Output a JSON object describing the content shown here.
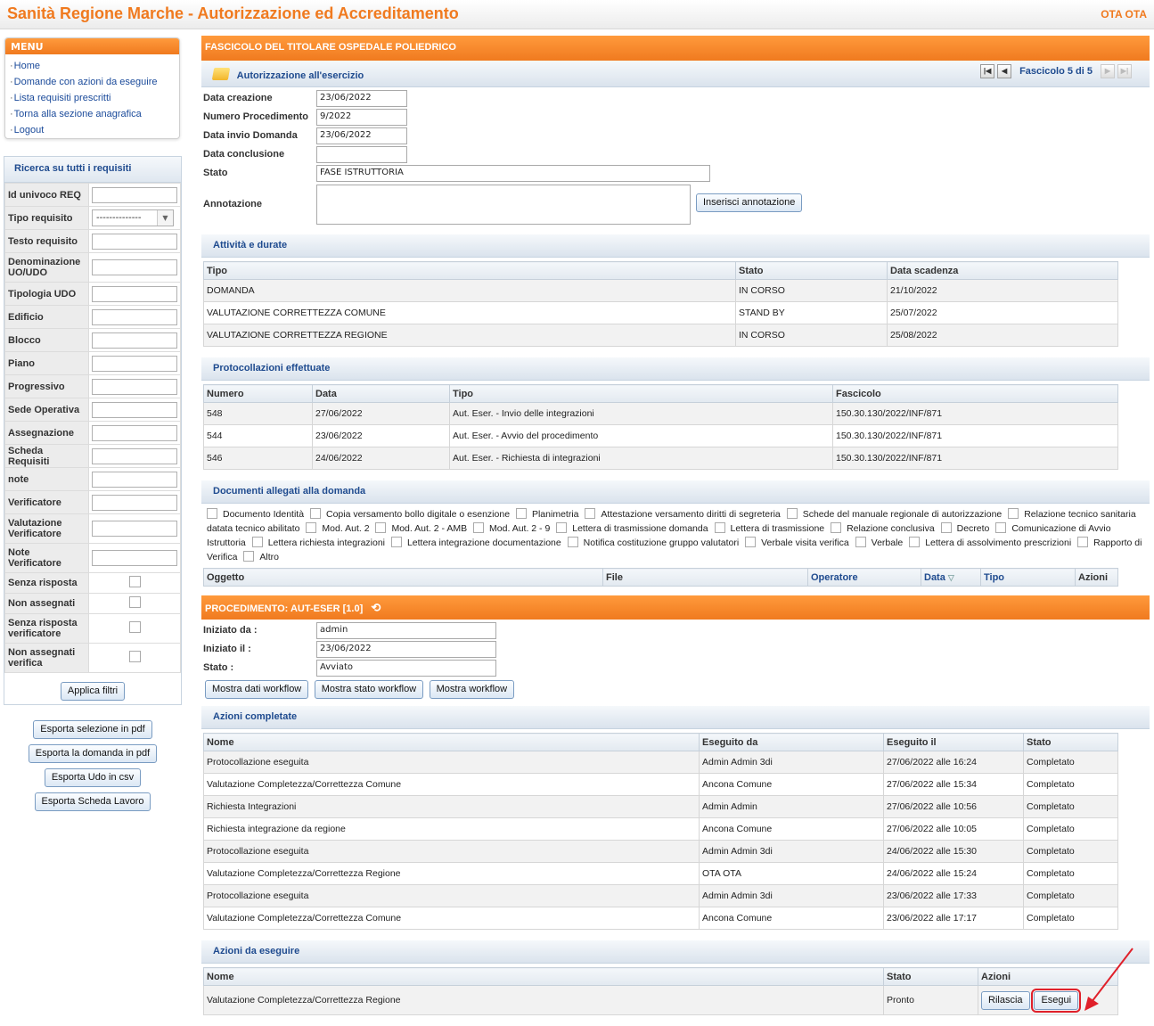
{
  "header": {
    "title": "Sanità Regione Marche - Autorizzazione ed Accreditamento",
    "user": "OTA OTA"
  },
  "menu": {
    "title": "MENU",
    "items": [
      "Home",
      "Domande con azioni da eseguire",
      "Lista requisiti prescritti",
      "Torna alla sezione anagrafica",
      "Logout"
    ]
  },
  "search": {
    "title": "Ricerca su tutti i requisiti",
    "fields": [
      "Id univoco REQ",
      "Tipo requisito",
      "Testo requisito",
      "Denominazione UO/UDO",
      "Tipologia UDO",
      "Edificio",
      "Blocco",
      "Piano",
      "Progressivo",
      "Sede Operativa",
      "Assegnazione",
      "Scheda Requisiti",
      "note",
      "Verificatore",
      "Valutazione Verificatore",
      "Note Verificatore"
    ],
    "tipo_requisito_value": "--------------",
    "checks": [
      "Senza risposta",
      "Non assegnati",
      "Senza risposta verificatore",
      "Non assegnati verifica"
    ],
    "apply": "Applica filtri"
  },
  "exports": [
    "Esporta selezione in pdf",
    "Esporta la domanda in pdf",
    "Esporta Udo in csv",
    "Esporta Scheda Lavoro"
  ],
  "fascicolo": {
    "title": "FASCICOLO DEL TITOLARE OSPEDALE POLIEDRICO",
    "subtitle": "Autorizzazione all'esercizio",
    "pager": "Fascicolo 5 di 5",
    "fields": [
      {
        "label": "Data creazione",
        "value": "23/06/2022"
      },
      {
        "label": "Numero Procedimento",
        "value": "9/2022"
      },
      {
        "label": "Data invio Domanda",
        "value": "23/06/2022"
      },
      {
        "label": "Data conclusione",
        "value": ""
      },
      {
        "label": "Stato",
        "value": "FASE ISTRUTTORIA"
      }
    ],
    "annotation_label": "Annotazione",
    "annotation_button": "Inserisci annotazione"
  },
  "attivita": {
    "title": "Attività e durate",
    "columns": [
      "Tipo",
      "Stato",
      "Data scadenza"
    ],
    "rows": [
      [
        "DOMANDA",
        "IN CORSO",
        "21/10/2022"
      ],
      [
        "VALUTAZIONE CORRETTEZZA COMUNE",
        "STAND BY",
        "25/07/2022"
      ],
      [
        "VALUTAZIONE CORRETTEZZA REGIONE",
        "IN CORSO",
        "25/08/2022"
      ]
    ]
  },
  "protocollazioni": {
    "title": "Protocollazioni effettuate",
    "columns": [
      "Numero",
      "Data",
      "Tipo",
      "Fascicolo"
    ],
    "rows": [
      [
        "548",
        "27/06/2022",
        "Aut. Eser. - Invio delle integrazioni",
        "150.30.130/2022/INF/871"
      ],
      [
        "544",
        "23/06/2022",
        "Aut. Eser. - Avvio del procedimento",
        "150.30.130/2022/INF/871"
      ],
      [
        "546",
        "24/06/2022",
        "Aut. Eser. - Richiesta di integrazioni",
        "150.30.130/2022/INF/871"
      ]
    ]
  },
  "documenti": {
    "title": "Documenti allegati alla domanda",
    "items": [
      "Documento Identità",
      "Copia versamento bollo digitale o esenzione",
      "Planimetria",
      "Attestazione versamento diritti di segreteria",
      "Schede del manuale regionale di autorizzazione",
      "Relazione tecnico sanitaria datata tecnico abilitato",
      "Mod. Aut. 2",
      "Mod. Aut. 2 - AMB",
      "Mod. Aut. 2 - 9",
      "Lettera di trasmissione domanda",
      "Lettera di trasmissione",
      "Relazione conclusiva",
      "Decreto",
      "Comunicazione di Avvio Istruttoria",
      "Lettera richiesta integrazioni",
      "Lettera integrazione documentazione",
      "Notifica costituzione gruppo valutatori",
      "Verbale visita verifica",
      "Verbale",
      "Lettera di assolvimento prescrizioni",
      "Rapporto di Verifica",
      "Altro"
    ],
    "columns": [
      "Oggetto",
      "File",
      "Operatore",
      "Data",
      "Tipo",
      "Azioni"
    ]
  },
  "procedimento": {
    "title": "PROCEDIMENTO: AUT-ESER [1.0]",
    "fields": [
      {
        "label": "Iniziato da :",
        "value": "admin"
      },
      {
        "label": "Iniziato il :",
        "value": "23/06/2022"
      },
      {
        "label": "Stato :",
        "value": "Avviato"
      }
    ],
    "buttons": [
      "Mostra dati workflow",
      "Mostra stato workflow",
      "Mostra workflow"
    ]
  },
  "azioni_completate": {
    "title": "Azioni completate",
    "columns": [
      "Nome",
      "Eseguito da",
      "Eseguito il",
      "Stato"
    ],
    "rows": [
      [
        "Protocollazione eseguita",
        "Admin Admin 3di",
        "27/06/2022 alle 16:24",
        "Completato"
      ],
      [
        "Valutazione Completezza/Correttezza Comune",
        "Ancona Comune",
        "27/06/2022 alle 15:34",
        "Completato"
      ],
      [
        "Richiesta Integrazioni",
        "Admin Admin",
        "27/06/2022 alle 10:56",
        "Completato"
      ],
      [
        "Richiesta integrazione da regione",
        "Ancona Comune",
        "27/06/2022 alle 10:05",
        "Completato"
      ],
      [
        "Protocollazione eseguita",
        "Admin Admin 3di",
        "24/06/2022 alle 15:30",
        "Completato"
      ],
      [
        "Valutazione Completezza/Correttezza Regione",
        "OTA OTA",
        "24/06/2022 alle 15:24",
        "Completato"
      ],
      [
        "Protocollazione eseguita",
        "Admin Admin 3di",
        "23/06/2022 alle 17:33",
        "Completato"
      ],
      [
        "Valutazione Completezza/Correttezza Comune",
        "Ancona Comune",
        "23/06/2022 alle 17:17",
        "Completato"
      ]
    ]
  },
  "azioni_da_eseguire": {
    "title": "Azioni da eseguire",
    "columns": [
      "Nome",
      "Stato",
      "Azioni"
    ],
    "rows": [
      {
        "nome": "Valutazione Completezza/Correttezza Regione",
        "stato": "Pronto",
        "rilascia": "Rilascia",
        "esegui": "Esegui"
      }
    ]
  },
  "colors": {
    "accent": "#f07a1f",
    "link": "#1a4a9a",
    "highlight": "#e0202a"
  }
}
